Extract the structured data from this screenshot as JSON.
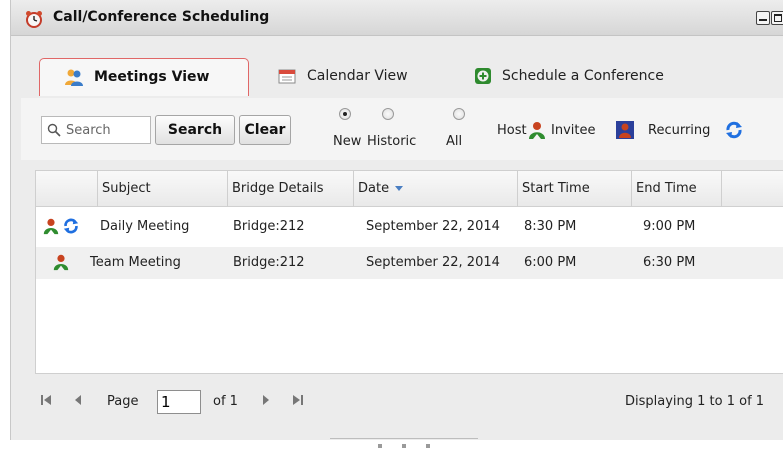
{
  "window": {
    "title": "Call/Conference Scheduling",
    "icons": {
      "title": "alarm-clock-icon",
      "minimize": "minimize-icon",
      "maximize": "maximize-icon"
    }
  },
  "tabs": [
    {
      "label": "Meetings View",
      "icon": "people-icon",
      "active": true
    },
    {
      "label": "Calendar View",
      "icon": "calendar-icon",
      "active": false
    },
    {
      "label": "Schedule a Conference",
      "icon": "plus-circle-icon",
      "active": false
    }
  ],
  "toolbar": {
    "search_placeholder": "Search",
    "search_button": "Search",
    "clear_button": "Clear",
    "filters": [
      {
        "label": "New",
        "selected": true
      },
      {
        "label": "Historic",
        "selected": false
      },
      {
        "label": "All",
        "selected": false
      }
    ],
    "legend": {
      "host": "Host",
      "invitee": "Invitee",
      "recurring": "Recurring"
    }
  },
  "table": {
    "columns": [
      "Subject",
      "Bridge Details",
      "Date",
      "Start Time",
      "End Time"
    ],
    "sort_column": "Date",
    "rows": [
      {
        "subject": "Daily Meeting",
        "bridge": "Bridge:212",
        "date": "September 22, 2014",
        "start": "8:30 PM",
        "end": "9:00 PM",
        "icons": [
          "host-icon",
          "recurring-icon"
        ]
      },
      {
        "subject": "Team Meeting",
        "bridge": "Bridge:212",
        "date": "September 22, 2014",
        "start": "6:00 PM",
        "end": "6:30 PM",
        "icons": [
          "host-icon"
        ]
      }
    ]
  },
  "pager": {
    "page_label": "Page",
    "page_value": "1",
    "of_label": "of 1",
    "display_text": "Displaying 1 to 1 of 1"
  },
  "colors": {
    "host": "#2f8c2f",
    "host_head": "#c8431f",
    "invitee": "#2b3f9b",
    "recurring": "#1f6fe0",
    "active_tab_border": "#e06767",
    "sort_arrow": "#4a7ec2"
  }
}
